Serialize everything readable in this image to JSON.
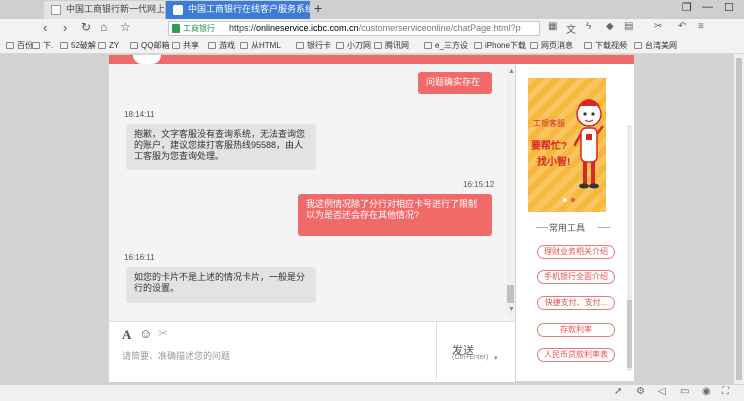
{
  "browser": {
    "tabs": [
      {
        "title": "中国工商银行新一代网上银行",
        "active": false
      },
      {
        "title": "中国工商银行在线客户服务系统",
        "active": true
      }
    ],
    "new_tab": "+",
    "window_controls": {
      "restore": "❐",
      "minimize": "—",
      "maximize": "☐"
    },
    "nav": {
      "back": "‹",
      "forward": "›",
      "reload": "↻",
      "home": "⌂",
      "star": "☆"
    },
    "address": {
      "badge": "工商银行",
      "scheme": "https://",
      "host": "onlineservice.icbc.com.cn",
      "path": "/customerserviceonline/chatPage.html?p"
    },
    "bookmarks": [
      "百份",
      "下.",
      "52破解",
      "ZY",
      "QQ邮箱",
      "共享",
      "游戏",
      "从HTML",
      "银行卡",
      "小刀网",
      "腾讯网",
      "e_三方设",
      "iPhone下载",
      "网页消息",
      "下载视频",
      "台湾美网"
    ]
  },
  "chat": {
    "messages": [
      {
        "role": "user",
        "text": "问题确实存在"
      },
      {
        "role": "time",
        "text": "18:14:11"
      },
      {
        "role": "bot",
        "text": "抱歉，文字客服没有查询系统，无法查询您的账户，建议您拨打客服热线95588，由人工客服为您查询处理。"
      },
      {
        "role": "time",
        "text": "16:15:12"
      },
      {
        "role": "user",
        "text": "我这例情况除了分行对相应卡号进行了限制以为是否还会存在其他情况?"
      },
      {
        "role": "time",
        "text": "16:16:11"
      },
      {
        "role": "bot",
        "text": "如您的卡片不是上述的情况卡片，一般是分行的设置。"
      }
    ],
    "toolbar": {
      "font": "A",
      "emoji": "☺",
      "cut": "✂"
    },
    "input_placeholder": "请简要、准确描述您的问题",
    "send_label": "发送",
    "send_hint": "(Ctrl+Enter)",
    "send_dropdown": "▾"
  },
  "side": {
    "banner": {
      "brand": "工银客服",
      "line1": "要帮忙?",
      "line2": "找小智!"
    },
    "tools_title": "常用工具",
    "tools": [
      "理财业务相关介绍",
      "手机银行全面介绍",
      "快捷支付、支付...",
      "存款利率",
      "人民币贷款利率表"
    ]
  },
  "status_icons": {
    "rocket": "➚",
    "settings": "⚙",
    "volume": "◁",
    "screen": "▭",
    "sound": "◉",
    "fullscreen": "⛶"
  },
  "colors": {
    "accent": "#ef6a68",
    "tab_active": "#3c7bd8",
    "banner": "#f7b83e"
  }
}
